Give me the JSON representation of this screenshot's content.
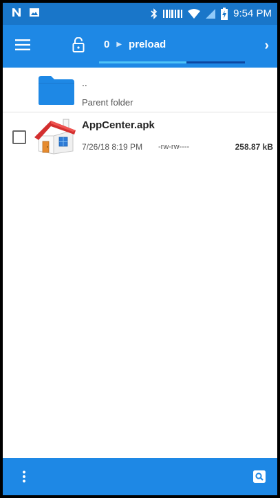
{
  "status_bar": {
    "time": "9:54 PM",
    "icons": [
      "n-notification-icon",
      "image-notification-icon",
      "bluetooth-icon",
      "vibrate-icon",
      "wifi-icon",
      "no-signal-icon",
      "battery-charging-icon"
    ]
  },
  "toolbar": {
    "menu_icon": "hamburger-menu-icon",
    "lock_icon": "unlock-icon",
    "path_index": "0",
    "path_folder": "preload",
    "next_icon": "chevron-right-icon",
    "progress_percent": 60
  },
  "list": {
    "parent": {
      "dots": "..",
      "label": "Parent folder",
      "icon": "folder-icon"
    },
    "files": [
      {
        "name": "AppCenter.apk",
        "date": "7/26/18 8:19 PM",
        "permissions": "-rw-rw----",
        "size": "258.87 kB",
        "checked": false,
        "icon": "house-icon"
      }
    ]
  },
  "bottom_bar": {
    "more_icon": "more-vertical-icon",
    "search_icon": "search-icon"
  },
  "colors": {
    "status_bar": "#1976c9",
    "toolbar": "#1e88e5",
    "progress_fill": "#4fc3f7",
    "progress_track": "#0d47a1",
    "folder": "#1e88e5"
  }
}
